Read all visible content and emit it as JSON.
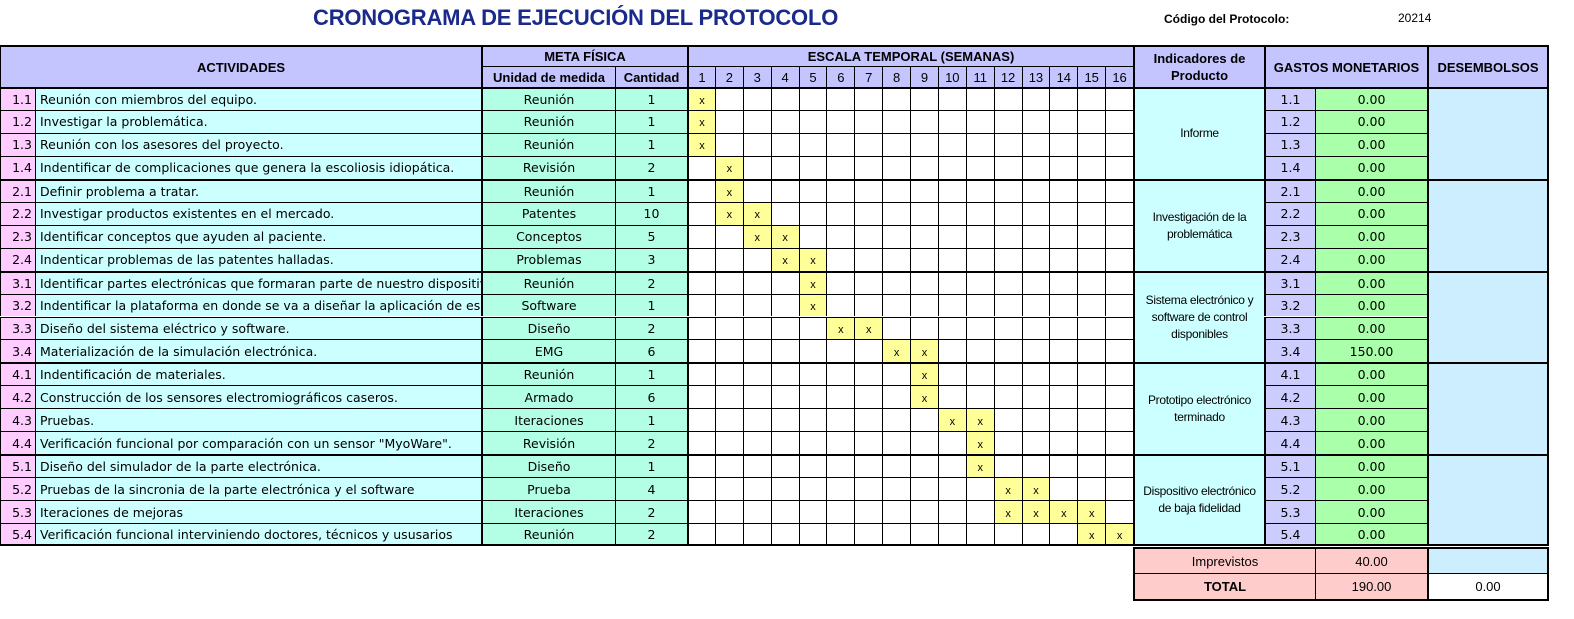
{
  "title": "CRONOGRAMA DE EJECUCIÓN DEL PROTOCOLO",
  "protocol_code_label": "Código del Protocolo:",
  "protocol_code": "20214",
  "headers": {
    "actividades": "ACTIVIDADES",
    "meta_fisica": "META FÍSICA",
    "unidad": "Unidad de medida",
    "cantidad": "Cantidad",
    "escala": "ESCALA TEMPORAL (SEMANAS)",
    "indicadores": "Indicadores de Producto",
    "gastos": "GASTOS MONETARIOS",
    "desembolsos": "DESEMBOLSOS"
  },
  "weeks": [
    "1",
    "2",
    "3",
    "4",
    "5",
    "6",
    "7",
    "8",
    "9",
    "10",
    "11",
    "12",
    "13",
    "14",
    "15",
    "16"
  ],
  "mark": "x",
  "colors": {
    "header_bg": "#c4c4ff",
    "num_bg": "#ffccff",
    "act_bg": "#ccffff",
    "meta_bg": "#b3ffe6",
    "mark_bg": "#ffff99",
    "gastos_num_bg": "#ccccff",
    "gastos_val_bg": "#aaffaa",
    "desemb_bg": "#cceeff",
    "total_bg": "#ffcccc",
    "title": "#1a2a8a"
  },
  "activities": [
    {
      "num": "1.1",
      "name": "Reunión con miembros del equipo.",
      "unit": "Reunión",
      "qty": "1",
      "weeks": [
        1
      ],
      "cost": "0.00"
    },
    {
      "num": "1.2",
      "name": "Investigar la problemática.",
      "unit": "Reunión",
      "qty": "1",
      "weeks": [
        1
      ],
      "cost": "0.00"
    },
    {
      "num": "1.3",
      "name": "Reunión con los asesores del proyecto.",
      "unit": "Reunión",
      "qty": "1",
      "weeks": [
        1
      ],
      "cost": "0.00"
    },
    {
      "num": "1.4",
      "name": "Indentificar de complicaciones que genera la escoliosis idiopática.",
      "unit": "Revisión",
      "qty": "2",
      "weeks": [
        2
      ],
      "cost": "0.00"
    },
    {
      "num": "2.1",
      "name": "Definir problema a tratar.",
      "unit": "Reunión",
      "qty": "1",
      "weeks": [
        2
      ],
      "cost": "0.00"
    },
    {
      "num": "2.2",
      "name": "Investigar productos existentes en el mercado.",
      "unit": "Patentes",
      "qty": "10",
      "weeks": [
        2,
        3
      ],
      "cost": "0.00"
    },
    {
      "num": "2.3",
      "name": "Identificar conceptos que ayuden al paciente.",
      "unit": "Conceptos",
      "qty": "5",
      "weeks": [
        3,
        4
      ],
      "cost": "0.00"
    },
    {
      "num": "2.4",
      "name": "Indenticar problemas de las patentes halladas.",
      "unit": "Problemas",
      "qty": "3",
      "weeks": [
        4,
        5
      ],
      "cost": "0.00"
    },
    {
      "num": "3.1",
      "name": "Identificar partes electrónicas que formaran parte de nuestro dispositivo",
      "unit": "Reunión",
      "qty": "2",
      "weeks": [
        5
      ],
      "cost": "0.00"
    },
    {
      "num": "3.2",
      "name": "Indentificar la plataforma en donde se va a diseñar la aplicación de escritorio",
      "unit": "Software",
      "qty": "1",
      "weeks": [
        5
      ],
      "cost": "0.00"
    },
    {
      "num": "3.3",
      "name": "Diseño del sistema eléctrico y software.",
      "unit": "Diseño",
      "qty": "2",
      "weeks": [
        6,
        7
      ],
      "cost": "0.00"
    },
    {
      "num": "3.4",
      "name": "Materialización de la simulación electrónica.",
      "unit": "EMG",
      "qty": "6",
      "weeks": [
        8,
        9
      ],
      "cost": "150.00"
    },
    {
      "num": "4.1",
      "name": "Indentificación de materiales.",
      "unit": "Reunión",
      "qty": "1",
      "weeks": [
        9
      ],
      "cost": "0.00"
    },
    {
      "num": "4.2",
      "name": "Construcción de los sensores electromiográficos caseros.",
      "unit": "Armado",
      "qty": "6",
      "weeks": [
        9
      ],
      "cost": "0.00"
    },
    {
      "num": "4.3",
      "name": "Pruebas.",
      "unit": "Iteraciones",
      "qty": "1",
      "weeks": [
        10,
        11
      ],
      "cost": "0.00"
    },
    {
      "num": "4.4",
      "name": "Verificación funcional por comparación con un sensor \"MyoWare\".",
      "unit": "Revisión",
      "qty": "2",
      "weeks": [
        11
      ],
      "cost": "0.00"
    },
    {
      "num": "5.1",
      "name": "Diseño del simulador de la parte electrónica.",
      "unit": "Diseño",
      "qty": "1",
      "weeks": [
        11
      ],
      "cost": "0.00"
    },
    {
      "num": "5.2",
      "name": "Pruebas de la sincronia de la parte electrónica y el software",
      "unit": "Prueba",
      "qty": "4",
      "weeks": [
        12,
        13
      ],
      "cost": "0.00"
    },
    {
      "num": "5.3",
      "name": "Iteraciones de mejoras",
      "unit": "Iteraciones",
      "qty": "2",
      "weeks": [
        12,
        13,
        14,
        15
      ],
      "cost": "0.00"
    },
    {
      "num": "5.4",
      "name": "Verificación funcional interviniendo doctores, técnicos y ususarios",
      "unit": "Reunión",
      "qty": "2",
      "weeks": [
        15,
        16
      ],
      "cost": "0.00"
    }
  ],
  "indicators": [
    {
      "text": "Informe",
      "rows": [
        0,
        3
      ]
    },
    {
      "text": "Investigación de la problemática",
      "rows": [
        4,
        7
      ]
    },
    {
      "text": "Sistema electrónico y software de control disponibles",
      "rows": [
        8,
        11
      ]
    },
    {
      "text": "Prototipo electrónico terminado",
      "rows": [
        12,
        15
      ]
    },
    {
      "text": "Dispositivo electrónico de baja fidelidad",
      "rows": [
        16,
        19
      ]
    }
  ],
  "imprevistos_label": "Imprevistos",
  "imprevistos_value": "40.00",
  "total_label": "TOTAL",
  "total_value": "190.00",
  "desembolsos_total": "0.00"
}
